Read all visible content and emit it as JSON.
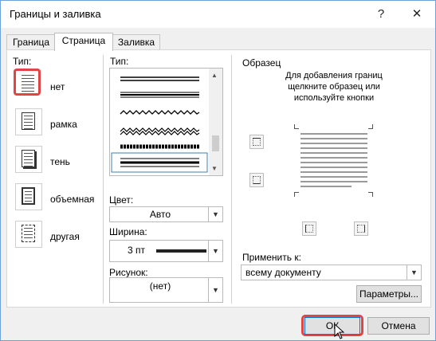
{
  "window": {
    "title": "Границы и заливка",
    "help": "?",
    "close": "✕"
  },
  "tabs": [
    {
      "label": "Граница",
      "active": false
    },
    {
      "label": "Страница",
      "active": true
    },
    {
      "label": "Заливка",
      "active": false
    }
  ],
  "setting": {
    "label": "Тип:",
    "items": [
      {
        "label": "нет",
        "selected": true
      },
      {
        "label": "рамка",
        "selected": false
      },
      {
        "label": "тень",
        "selected": false
      },
      {
        "label": "объемная",
        "selected": false
      },
      {
        "label": "другая",
        "selected": false
      }
    ]
  },
  "style": {
    "label": "Тип:",
    "color_label": "Цвет:",
    "color_value": "Авто",
    "width_label": "Ширина:",
    "width_value": "3 пт",
    "art_label": "Рисунок:",
    "art_value": "(нет)"
  },
  "preview": {
    "label": "Образец",
    "hint": "Для добавления границ щелкните образец или используйте кнопки"
  },
  "apply": {
    "label": "Применить к:",
    "value": "всему документу",
    "options_button": "Параметры..."
  },
  "footer": {
    "ok": "ОК",
    "cancel": "Отмена"
  },
  "colors": {
    "accent": "#e04545",
    "selection": "#3c7fb1"
  }
}
